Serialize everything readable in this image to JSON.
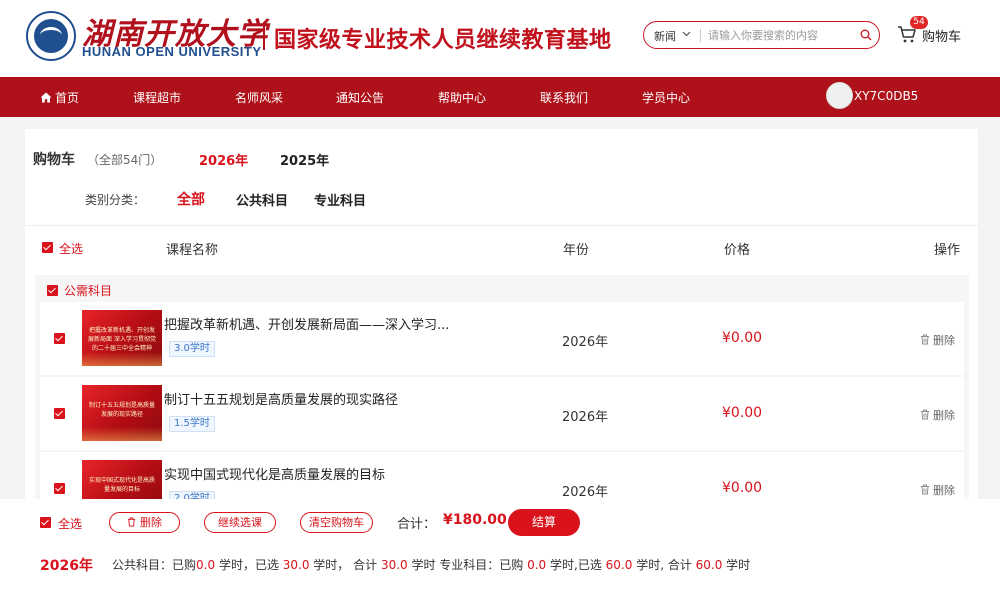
{
  "header": {
    "logo_cn": "湖南开放大学",
    "logo_en": "HUNAN OPEN UNIVERSITY",
    "site_title": "国家级专业技术人员继续教育基地",
    "search": {
      "category": "新闻",
      "placeholder": "请输入你要搜索的内容"
    },
    "cart": {
      "label": "购物车",
      "badge": "54"
    }
  },
  "nav": {
    "items": [
      "首页",
      "课程超市",
      "名师风采",
      "通知公告",
      "帮助中心",
      "联系我们",
      "学员中心"
    ],
    "username": "XY7C0DB5"
  },
  "cart_page": {
    "title": "购物车",
    "count_text": "（全部54门）",
    "year_tabs": [
      "2026年",
      "2025年"
    ],
    "category_label": "类别分类：",
    "categories": [
      "全部",
      "公共科目",
      "专业科目"
    ],
    "table_headers": {
      "select_all": "全选",
      "name": "课程名称",
      "year": "年份",
      "price": "价格",
      "action": "操作"
    },
    "group": {
      "label": "公需科目",
      "rows": [
        {
          "name": "把握改革新机遇、开创发展新局面——深入学习...",
          "hours": "3.0学时",
          "year": "2026年",
          "price": "¥0.00",
          "delete": "删除",
          "thumb_text": "把握改革新机遇、开创发展新局面 深入学习贯彻党的二十届三中全会精神"
        },
        {
          "name": "制订十五五规划是高质量发展的现实路径",
          "hours": "1.5学时",
          "year": "2026年",
          "price": "¥0.00",
          "delete": "删除",
          "thumb_text": "制订十五五规划是高质量发展的现实路径"
        },
        {
          "name": "实现中国式现代化是高质量发展的目标",
          "hours": "2.0学时",
          "year": "2026年",
          "price": "¥0.00",
          "delete": "删除",
          "thumb_text": "实现中国式现代化是高质量发展的目标"
        }
      ]
    }
  },
  "footer": {
    "select_all": "全选",
    "delete": "删除",
    "continue": "继续选课",
    "clear": "清空购物车",
    "total_label": "合计：",
    "total_value": "¥180.00",
    "checkout": "结算",
    "summary": {
      "year": "2026年",
      "public_label": "公共科目：",
      "bought_prefix": "已购",
      "public_bought": "0.0",
      "selected_prefix": " 学时，已选 ",
      "public_selected": "30.0",
      "total_prefix": " 学时， 合计 ",
      "public_total": "30.0",
      "pro_label": " 学时   专业科目：已购 ",
      "pro_bought": "0.0",
      "pro_selected_prefix": " 学时,已选 ",
      "pro_selected": "60.0",
      "pro_total_prefix": " 学时, 合计 ",
      "pro_total": "60.0",
      "tail": " 学时"
    }
  }
}
